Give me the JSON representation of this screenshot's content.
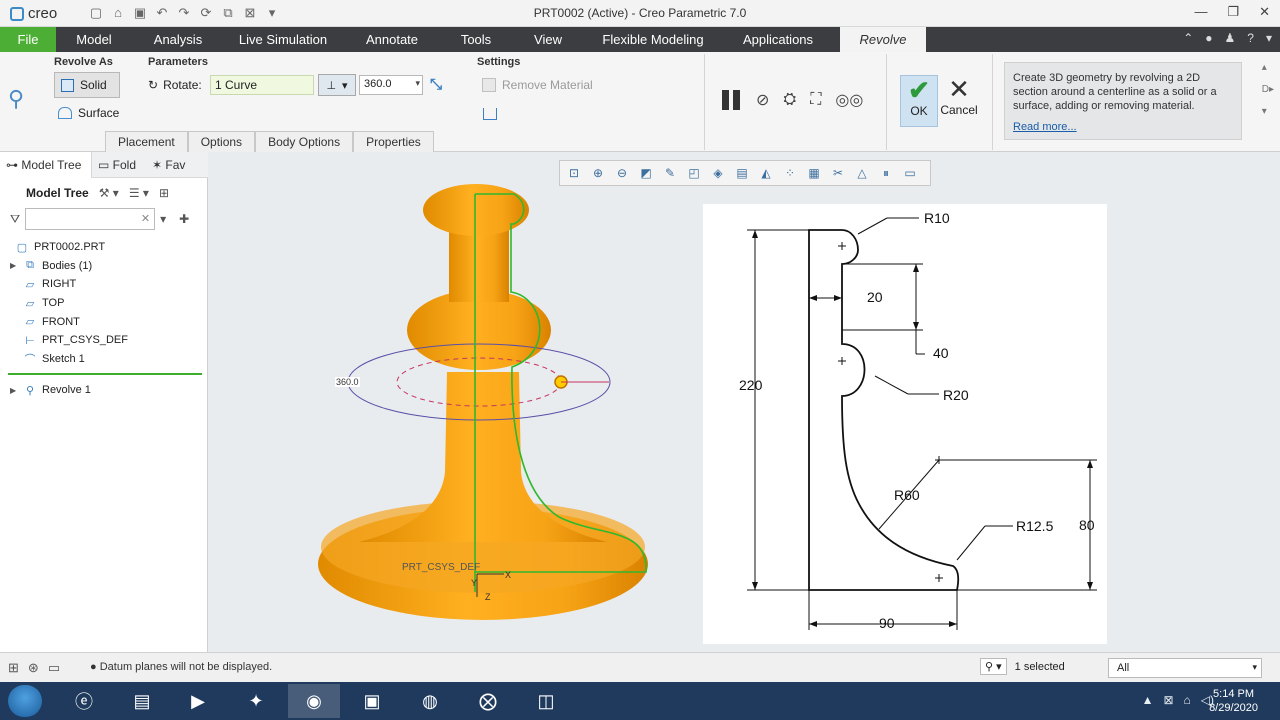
{
  "window": {
    "app_logo": "creo",
    "title": "PRT0002 (Active) - Creo Parametric 7.0",
    "controls": [
      "—",
      "❐",
      "✕"
    ]
  },
  "quick_access": [
    "new",
    "open",
    "save",
    "undo",
    "redo",
    "regenerate",
    "windows",
    "close"
  ],
  "ribbon_tabs": [
    "File",
    "Model",
    "Analysis",
    "Live Simulation",
    "Annotate",
    "Tools",
    "View",
    "Flexible Modeling",
    "Applications",
    "Revolve"
  ],
  "ribbon": {
    "revolve_as_label": "Revolve As",
    "solid_label": "Solid",
    "surface_label": "Surface",
    "parameters_label": "Parameters",
    "rotate_label": "Rotate:",
    "rotate_value": "1 Curve",
    "angle_value": "360.0",
    "settings_label": "Settings",
    "remove_material_label": "Remove Material",
    "subtabs": [
      "Placement",
      "Options",
      "Body Options",
      "Properties"
    ],
    "ok_label": "OK",
    "cancel_label": "Cancel",
    "help_text": "Create 3D geometry by revolving a 2D section around a centerline as a solid or a surface, adding or removing material.",
    "help_link": "Read more...",
    "more_label": "D"
  },
  "left_panel": {
    "tabs": [
      "Model Tree",
      "Fold",
      "Fav"
    ],
    "header": "Model Tree",
    "filter_placeholder": "",
    "items": [
      {
        "label": "PRT0002.PRT",
        "icon": "part-icon",
        "expand": ""
      },
      {
        "label": "Bodies (1)",
        "icon": "bodies-icon",
        "expand": "▶"
      },
      {
        "label": "RIGHT",
        "icon": "datum-plane-icon",
        "expand": ""
      },
      {
        "label": "TOP",
        "icon": "datum-plane-icon",
        "expand": ""
      },
      {
        "label": "FRONT",
        "icon": "datum-plane-icon",
        "expand": ""
      },
      {
        "label": "PRT_CSYS_DEF",
        "icon": "csys-icon",
        "expand": ""
      },
      {
        "label": "Sketch 1",
        "icon": "sketch-icon",
        "expand": ""
      }
    ],
    "feature": {
      "label": "Revolve 1",
      "icon": "revolve-icon",
      "expand": "▶"
    }
  },
  "graphics": {
    "angle_label": "360.0",
    "csys_label": "PRT_CSYS_DEF",
    "axis_labels": {
      "x": "X",
      "y": "Y",
      "z": "Z"
    },
    "body_color": "#f5a623"
  },
  "drawing": {
    "dims": {
      "r10": "R10",
      "d20": "20",
      "d40": "40",
      "d220": "220",
      "r20": "R20",
      "r60": "R60",
      "r12_5": "R12.5",
      "d80": "80",
      "d90": "90"
    }
  },
  "statusbar": {
    "message": "Datum planes will not be displayed.",
    "selected": "1 selected",
    "filter": "All"
  },
  "taskbar": {
    "clock_time": "5:14 PM",
    "clock_date": "8/29/2020"
  }
}
